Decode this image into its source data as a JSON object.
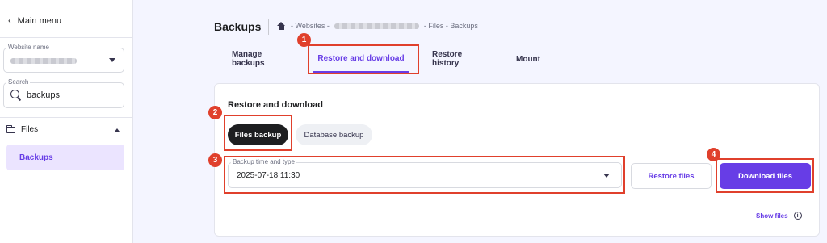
{
  "sidebar": {
    "main_menu": "Main menu",
    "website_label": "Website name",
    "search_label": "Search",
    "search_value": "backups",
    "files_label": "Files",
    "backups_label": "Backups"
  },
  "header": {
    "title": "Backups",
    "breadcrumb_websites": "- Websites -",
    "breadcrumb_rest": "- Files - Backups"
  },
  "tabs": [
    {
      "label": "Manage backups"
    },
    {
      "label": "Restore and download"
    },
    {
      "label": "Restore history"
    },
    {
      "label": "Mount"
    }
  ],
  "card": {
    "title": "Restore and download",
    "files_backup": "Files backup",
    "database_backup": "Database backup",
    "select_label": "Backup time and type",
    "select_value": "2025-07-18 11:30",
    "restore_button": "Restore files",
    "download_button": "Download files",
    "show_files": "Show files",
    "info_glyph": "i"
  },
  "annotations": [
    "1",
    "2",
    "3",
    "4"
  ],
  "colors": {
    "accent": "#673de6",
    "highlight": "#e0402c"
  }
}
